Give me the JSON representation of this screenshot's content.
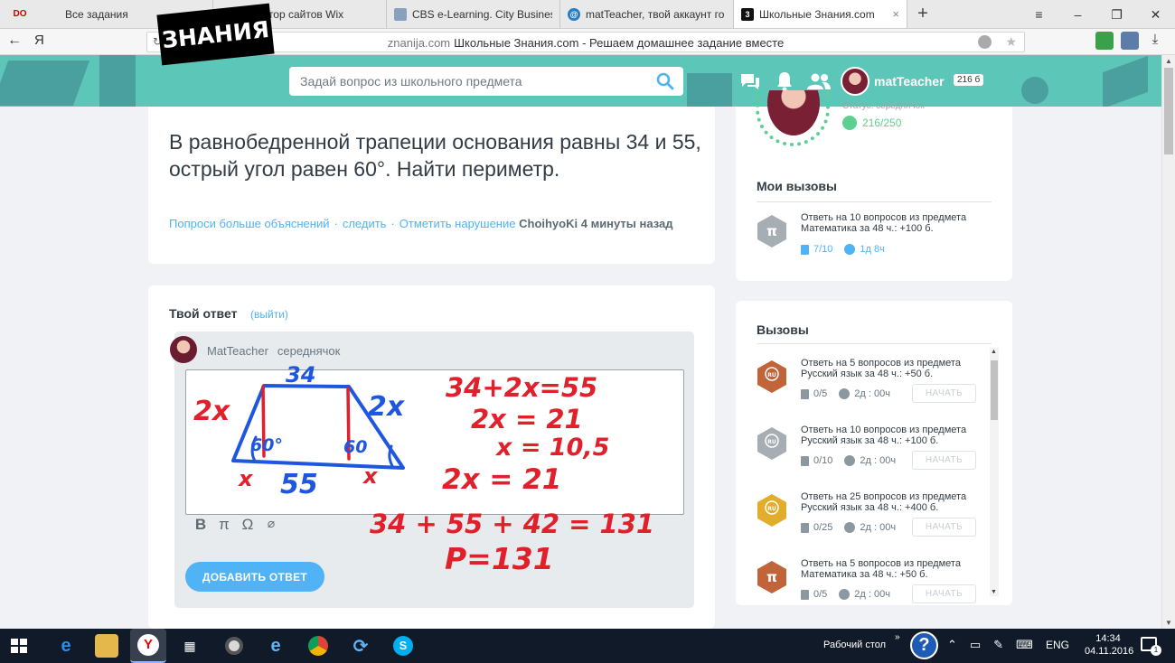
{
  "browser": {
    "tab_logo": "DO",
    "tabs": [
      {
        "title": "Все задания",
        "fav_color": "#e9e9e9",
        "fav_text": ""
      },
      {
        "title": "Редактор сайтов Wix",
        "fav_color": "#3899ec",
        "fav_text": "✕"
      },
      {
        "title": "CBS e-Learning. City Busines",
        "fav_color": "#8aa1bd",
        "fav_text": ""
      },
      {
        "title": "matTeacher, твой аккаунт го",
        "fav_color": "#2a7cc4",
        "fav_text": "@"
      },
      {
        "title": "Школьные Знания.com",
        "fav_color": "#111111",
        "fav_text": "3"
      }
    ],
    "tab_close": "×",
    "new_tab": "+",
    "back": "←",
    "yandex": "Я",
    "reload": "↻",
    "url_host": "znanija.com",
    "url_title": "Школьные Знания.com - Решаем домашнее задание вместе",
    "star": "★",
    "min": "–",
    "max": "❐",
    "close": "✕",
    "menu": "≡"
  },
  "header": {
    "logo": "ЗНАНИЯ",
    "search_placeholder": "Задай вопрос из школьного предмета",
    "username": "matTeacher",
    "points_badge": "216 б"
  },
  "question": {
    "text": "В равнобедренной трапеции основания равны 34 и 55, острый угол равен 60°. Найти периметр.",
    "links": [
      "Попроси больше объяснений",
      "следить",
      "Отметить нарушение"
    ],
    "separator": "·",
    "author": "ChoihyoKi",
    "time": "4 минуты назад"
  },
  "answer": {
    "title": "Твой ответ",
    "exit_link": "(выйти)",
    "user": "MatTeacher",
    "rank": "середнячок",
    "tools": [
      "B",
      "π",
      "Ω",
      "⌀"
    ],
    "submit": "ДОБАВИТЬ ОТВЕТ"
  },
  "handwriting": {
    "side_left": "2x",
    "side_right": "2x",
    "top_base": "34",
    "bottom_base": "55",
    "angle_left": "60°",
    "angle_right": "60",
    "seg_left": "x",
    "seg_right": "x",
    "eq1": "34+2x=55",
    "eq2": "2x = 21",
    "eq3": "x = 10,5",
    "eq4": "2x = 21",
    "eq5": "34 + 55 + 42 = 131",
    "eq6": "P=131"
  },
  "profile": {
    "rank_text": "Статус: середнячок",
    "points": "216/250"
  },
  "my_challenges": {
    "title": "Мои вызовы",
    "items": [
      {
        "text": "Ответь на 10 вопросов из предмета Математика за 48 ч.: +100 б.",
        "progress": "7/10",
        "time": "1д  8ч",
        "icon": "π",
        "color": "#a6adb3"
      }
    ]
  },
  "challenges": {
    "title": "Вызовы",
    "start_label": "НАЧАТЬ",
    "items": [
      {
        "text": "Ответь на 5 вопросов из предмета Русский язык за 48 ч.: +50 б.",
        "progress": "0/5",
        "time": "2д : 00ч",
        "icon": "RU",
        "color": "#c0643a"
      },
      {
        "text": "Ответь на 10 вопросов из предмета Русский язык за 48 ч.: +100 б.",
        "progress": "0/10",
        "time": "2д : 00ч",
        "icon": "RU",
        "color": "#a6adb3"
      },
      {
        "text": "Ответь на 25 вопросов из предмета Русский язык за 48 ч.: +400 б.",
        "progress": "0/25",
        "time": "2д : 00ч",
        "icon": "RU",
        "color": "#e2ad2b"
      },
      {
        "text": "Ответь на 5 вопросов из предмета Математика за 48 ч.: +50 б.",
        "progress": "0/5",
        "time": "2д : 00ч",
        "icon": "π",
        "color": "#c0643a"
      }
    ]
  },
  "taskbar": {
    "desktop": "Рабочий стол",
    "chevron": "»",
    "help": "?",
    "lang": "ENG",
    "time": "14:34",
    "date": "04.11.2016",
    "notif_count": "1"
  }
}
